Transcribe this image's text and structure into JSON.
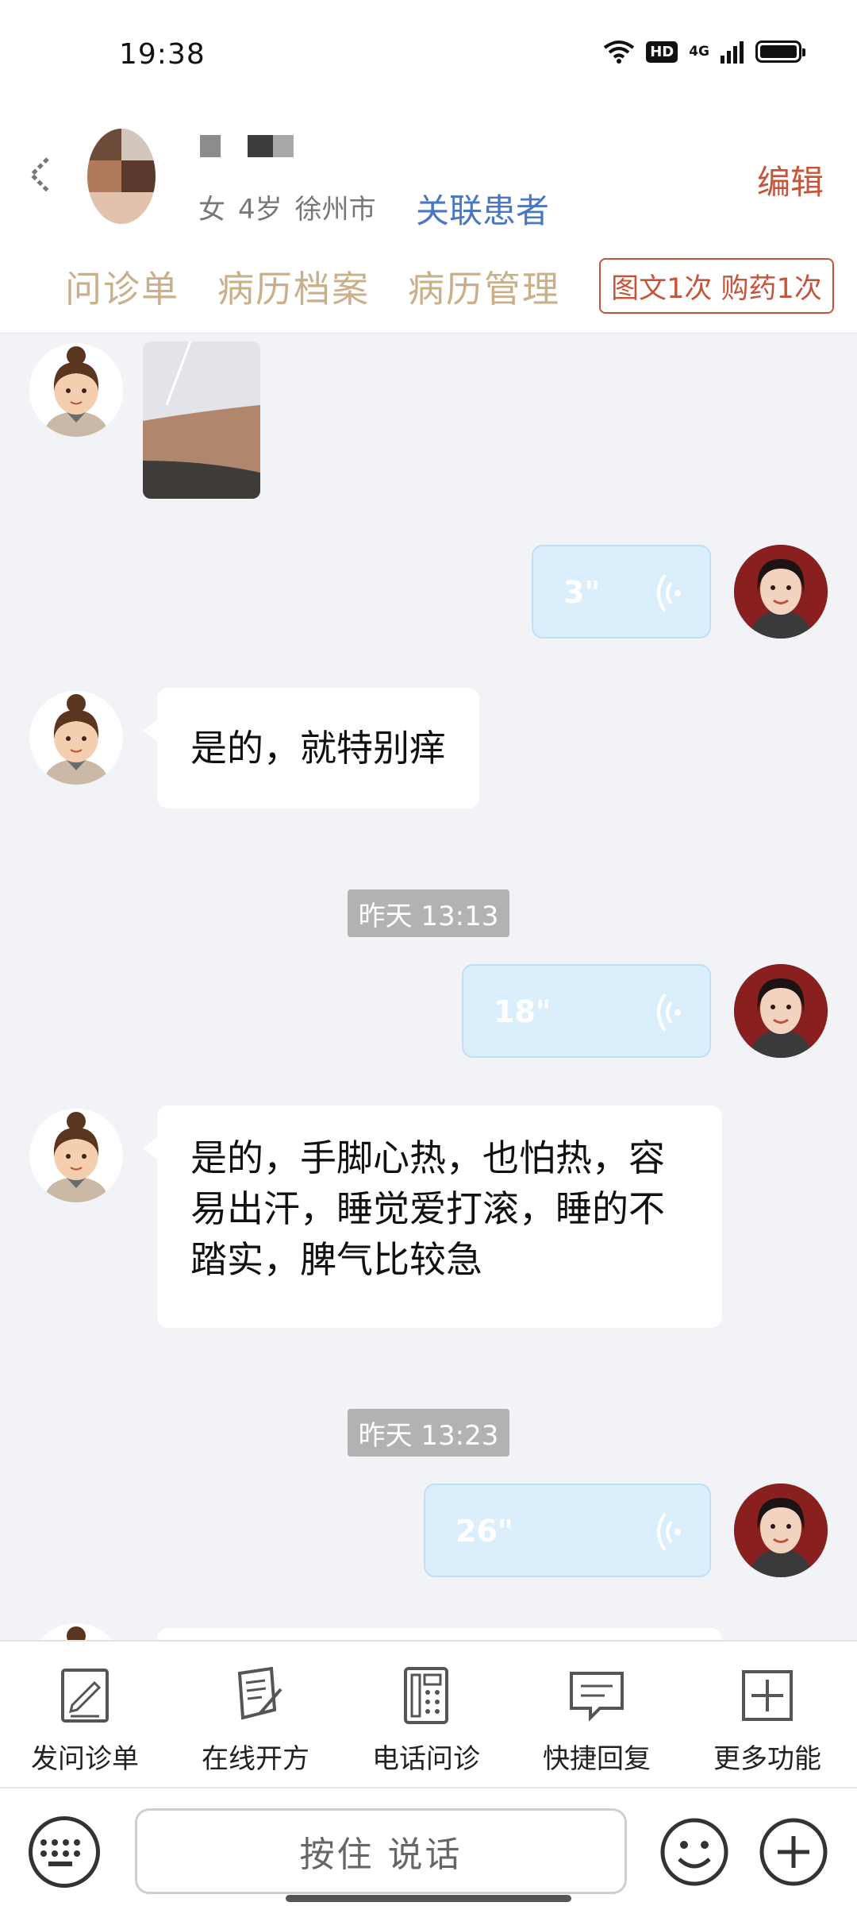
{
  "status_bar": {
    "time": "19:38",
    "hd_label": "HD",
    "network_label": "4G",
    "icons": [
      "wifi-icon",
      "hd-icon",
      "signal-icon",
      "battery-icon"
    ]
  },
  "header": {
    "back_icon": "back-icon",
    "patient_meta": {
      "gender": "女",
      "age": "4岁",
      "city": "徐州市"
    },
    "link_patient": "关联患者",
    "edit_label": "编辑",
    "tabs": [
      "问诊单",
      "病历档案",
      "病历管理"
    ],
    "quota_badge": "图文1次 购药1次",
    "colors": {
      "tab": "#c9b08a",
      "accent": "#c4543b",
      "link": "#4a77c4"
    }
  },
  "chat": {
    "messages": [
      {
        "from": "patient",
        "type": "image"
      },
      {
        "from": "doctor",
        "type": "voice",
        "duration": "3\""
      },
      {
        "from": "patient",
        "type": "text",
        "text": "是的，就特别痒"
      },
      {
        "type": "time",
        "text": "昨天 13:13"
      },
      {
        "from": "doctor",
        "type": "voice",
        "duration": "18\""
      },
      {
        "from": "patient",
        "type": "text",
        "lines": [
          "是的，手脚心热，也怕热，容",
          "易出汗，睡觉爱打滚，睡的不",
          "踏实，脾气比较急"
        ]
      },
      {
        "type": "time",
        "text": "昨天 13:23"
      },
      {
        "from": "doctor",
        "type": "voice",
        "duration": "26\""
      }
    ],
    "colors": {
      "background": "#f2f3f7",
      "voice_bubble": "#dbeefc",
      "timestamp": "#b2b2b2"
    }
  },
  "toolbar": {
    "items": [
      {
        "label": "发问诊单",
        "icon": "questionnaire-icon"
      },
      {
        "label": "在线开方",
        "icon": "prescription-icon"
      },
      {
        "label": "电话问诊",
        "icon": "phone-icon"
      },
      {
        "label": "快捷回复",
        "icon": "quick-reply-icon"
      },
      {
        "label": "更多功能",
        "icon": "more-icon"
      }
    ]
  },
  "input_bar": {
    "voice_placeholder": "按住 说话",
    "icons": [
      "keyboard-icon",
      "emoji-icon",
      "plus-icon"
    ]
  }
}
